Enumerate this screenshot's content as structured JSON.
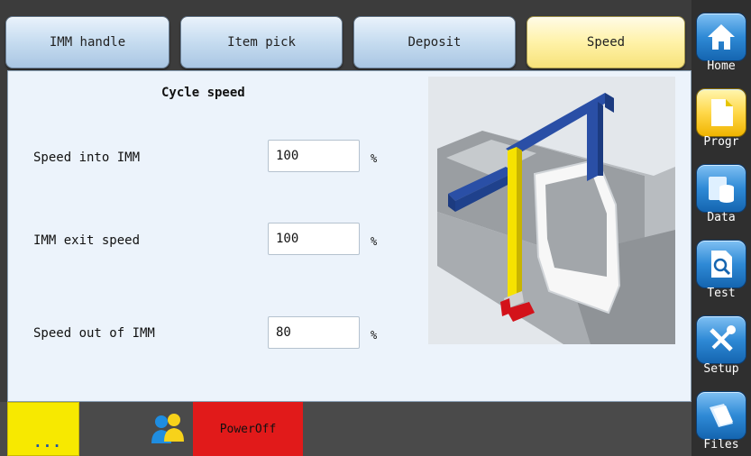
{
  "tabs": [
    {
      "label": "IMM handle",
      "active": false
    },
    {
      "label": "Item pick",
      "active": false
    },
    {
      "label": "Deposit",
      "active": false
    },
    {
      "label": "Speed",
      "active": true
    }
  ],
  "panel": {
    "title": "Cycle speed",
    "rows": [
      {
        "label": "Speed into IMM",
        "value": "100",
        "unit": "%"
      },
      {
        "label": "IMM exit speed",
        "value": "100",
        "unit": "%"
      },
      {
        "label": "Speed out of IMM",
        "value": "80",
        "unit": "%"
      }
    ]
  },
  "bottom": {
    "more_label": "...",
    "poweroff_label": "PowerOff"
  },
  "sidebar": {
    "items": [
      {
        "label": "Home",
        "icon": "home-icon",
        "active": false
      },
      {
        "label": "Progr",
        "icon": "document-icon",
        "active": true
      },
      {
        "label": "Data",
        "icon": "database-icon",
        "active": false
      },
      {
        "label": "Test",
        "icon": "magnifier-document-icon",
        "active": false
      },
      {
        "label": "Setup",
        "icon": "tools-icon",
        "active": false
      },
      {
        "label": "Files",
        "icon": "files-icon",
        "active": false
      }
    ]
  },
  "colors": {
    "active_tab": "#fff2a8",
    "sidebar_button": "#2f8ad6",
    "sidebar_active": "#ffd84a",
    "poweroff": "#e11a1a",
    "more_button": "#f7e900"
  }
}
